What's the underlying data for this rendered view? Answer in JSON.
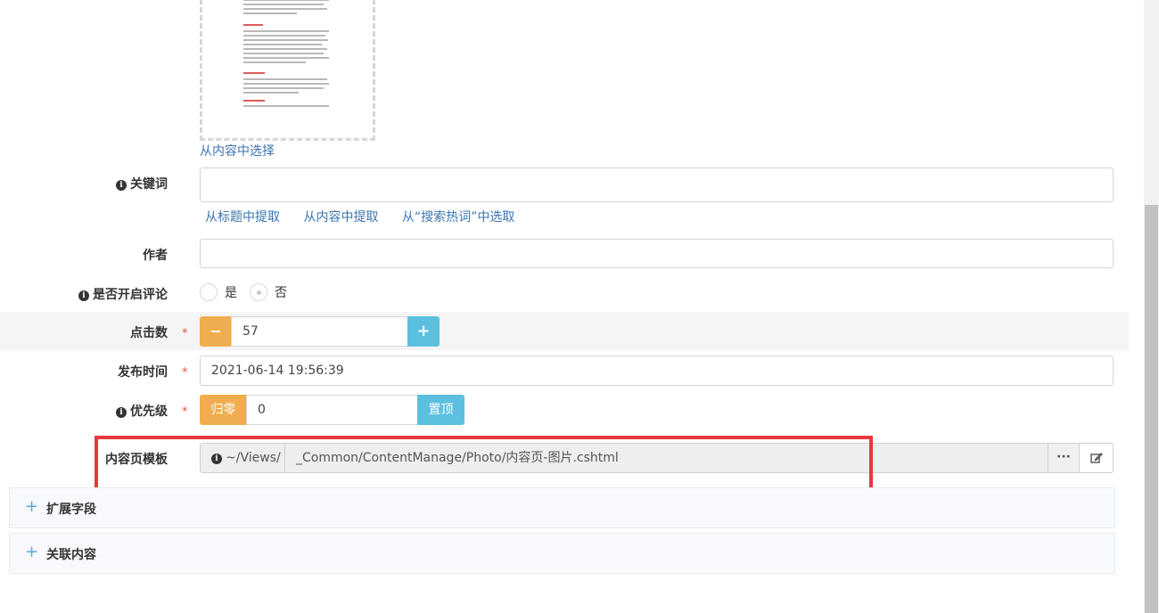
{
  "thumbnail": {
    "choose_link": "从内容中选择"
  },
  "keywords": {
    "label": "关键词",
    "value": "",
    "links": [
      "从标题中提取",
      "从内容中提取",
      "从“搜索热词”中选取"
    ]
  },
  "author": {
    "label": "作者",
    "value": ""
  },
  "comments": {
    "label": "是否开启评论",
    "options": [
      "是",
      "否"
    ],
    "selected": "否"
  },
  "clicks": {
    "label": "点击数",
    "required_mark": "*",
    "value": "57",
    "minus_label": "−",
    "plus_label": "+"
  },
  "publish_time": {
    "label": "发布时间",
    "required_mark": "*",
    "value": "2021-06-14 19:56:39"
  },
  "priority": {
    "label": "优先级",
    "required_mark": "*",
    "reset_label": "归零",
    "value": "0",
    "top_label": "置顶"
  },
  "template": {
    "label": "内容页模板",
    "prefix": "~/Views/",
    "value": "_Common/ContentManage/Photo/内容页-图片.cshtml",
    "browse_label": "···",
    "edit_icon": "edit-icon"
  },
  "panels": [
    {
      "icon": "+",
      "title": "扩展字段"
    },
    {
      "icon": "+",
      "title": "关联内容"
    }
  ],
  "colors": {
    "link": "#3a74b0",
    "orange": "#f0ad4e",
    "blue": "#5bc0de",
    "highlight_box": "#e8393c"
  }
}
